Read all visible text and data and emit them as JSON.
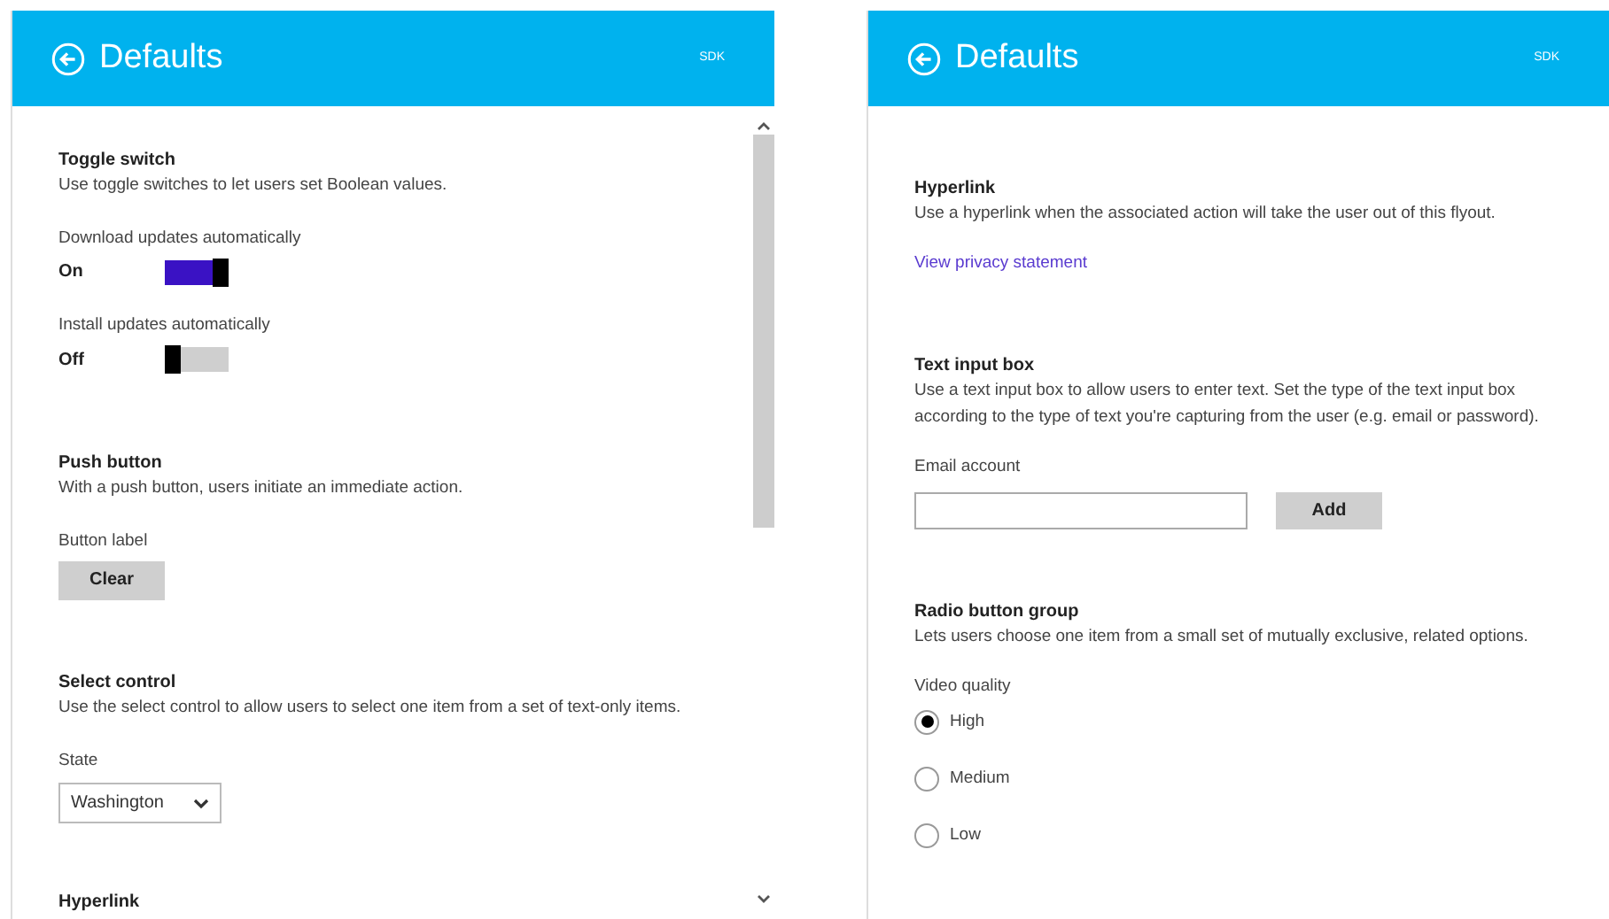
{
  "panels": [
    {
      "header": {
        "title": "Defaults",
        "badge": "SDK"
      },
      "scrollbar": true,
      "sections": [
        {
          "kind": "toggles",
          "title": "Toggle switch",
          "description": "Use toggle switches to let users set Boolean values.",
          "items": [
            {
              "label": "Download updates automatically",
              "state_label": "On",
              "on": true
            },
            {
              "label": "Install updates automatically",
              "state_label": "Off",
              "on": false
            }
          ]
        },
        {
          "kind": "button",
          "title": "Push button",
          "description": "With a push button, users initiate an immediate action.",
          "label": "Button label",
          "button": "Clear"
        },
        {
          "kind": "select",
          "title": "Select control",
          "description": "Use the select control to allow users to select one item from a set of text-only items.",
          "label": "State",
          "value": "Washington"
        },
        {
          "kind": "heading",
          "title": "Hyperlink"
        }
      ]
    },
    {
      "header": {
        "title": "Defaults",
        "badge": "SDK"
      },
      "scrollbar": false,
      "sections": [
        {
          "kind": "link",
          "title": "Hyperlink",
          "description": "Use a hyperlink when the associated action will take the user out of this flyout.",
          "link": "View privacy statement"
        },
        {
          "kind": "text_input",
          "title": "Text input box",
          "description": "Use a text input box to allow users to enter text. Set the type of the text input box according to the type of text you're capturing from the user (e.g. email or password).",
          "label": "Email account",
          "button": "Add"
        },
        {
          "kind": "radio",
          "title": "Radio button group",
          "description": "Lets users choose one item from a small set of mutually exclusive, related options.",
          "label": "Video quality",
          "options": [
            {
              "label": "High",
              "selected": true
            },
            {
              "label": "Medium",
              "selected": false
            },
            {
              "label": "Low",
              "selected": false
            }
          ]
        }
      ]
    }
  ]
}
